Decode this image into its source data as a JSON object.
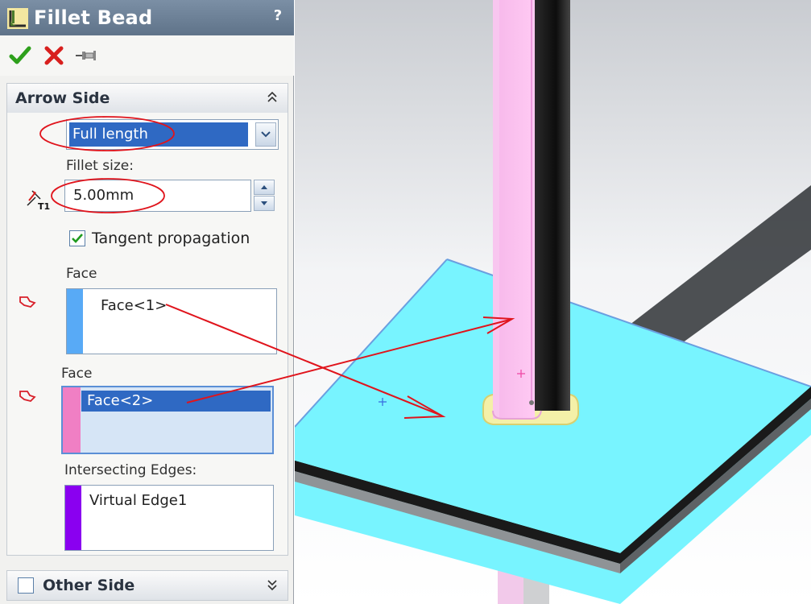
{
  "panel": {
    "title": "Fillet Bead",
    "help": "?",
    "actions": {
      "ok": "check-icon",
      "cancel": "x-icon",
      "pin": "pushpin-icon"
    }
  },
  "arrow_side": {
    "title": "Arrow Side",
    "bead_length": "Full length",
    "fillet_size_label": "Fillet size:",
    "fillet_size_value": "5.00mm",
    "tangent_propagation_label": "Tangent propagation",
    "tangent_propagation_checked": true,
    "face_set1_label": "Face",
    "face_set1_items": [
      "Face<1>"
    ],
    "face_set2_label": "Face",
    "face_set2_items": [
      "Face<2>"
    ],
    "intersecting_edges_label": "Intersecting Edges:",
    "intersecting_edges_items": [
      "Virtual Edge1"
    ]
  },
  "other_side": {
    "title": "Other Side",
    "checked": false
  },
  "colors": {
    "face_set1": "#58aaf6",
    "face_set2": "#f07fc4",
    "intersecting_edges": "#8a00f0",
    "highlight": "#2f69c3",
    "annotation": "#e0141c"
  }
}
